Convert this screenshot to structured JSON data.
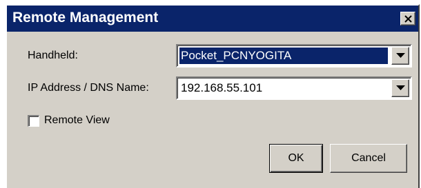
{
  "window": {
    "title": "Remote Management",
    "close_icon": "close-icon"
  },
  "form": {
    "handheld_label": "Handheld:",
    "handheld_value": "Pocket_PCNYOGITA",
    "ip_label": "IP Address / DNS Name:",
    "ip_value": "192.168.55.101",
    "remote_view_label": "Remote View",
    "remote_view_checked": false
  },
  "buttons": {
    "ok_label": "OK",
    "cancel_label": "Cancel"
  },
  "colors": {
    "titlebar": "#0a246a",
    "dialog_face": "#d4d0c8",
    "selection": "#0a246a"
  }
}
